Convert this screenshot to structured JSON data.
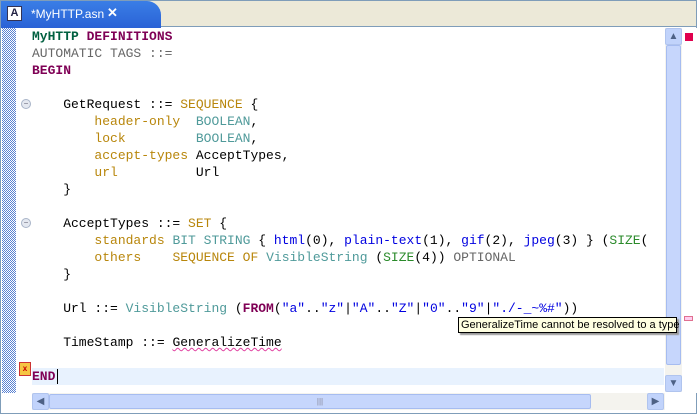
{
  "tab": {
    "title": "*MyHTTP.asn",
    "icon": "asn-file-icon",
    "close": "✕",
    "icon_letter": "A"
  },
  "colors": {
    "keyword": "#7f0055",
    "module": "#006040",
    "type": "#4f9a9a",
    "field": "#b8860b",
    "value": "#0000e0",
    "size": "#2a8a2a",
    "error": "#e0004e"
  },
  "code": [
    [
      [
        "MyHTTP",
        "mod"
      ],
      [
        " ",
        "pl"
      ],
      [
        "DEFINITIONS",
        "kw"
      ]
    ],
    [
      [
        "AUTOMATIC TAGS ::=",
        "gr"
      ]
    ],
    [
      [
        "BEGIN",
        "kw"
      ]
    ],
    [],
    [
      [
        "    GetRequest ::= ",
        "pl"
      ],
      [
        "SEQUENCE",
        "or"
      ],
      [
        " {",
        "pl"
      ]
    ],
    [
      [
        "        ",
        "pl"
      ],
      [
        "header-only",
        "or"
      ],
      [
        "  ",
        "pl"
      ],
      [
        "BOOLEAN",
        "te"
      ],
      [
        ",",
        "pl"
      ]
    ],
    [
      [
        "        ",
        "pl"
      ],
      [
        "lock",
        "or"
      ],
      [
        "         ",
        "pl"
      ],
      [
        "BOOLEAN",
        "te"
      ],
      [
        ",",
        "pl"
      ]
    ],
    [
      [
        "        ",
        "pl"
      ],
      [
        "accept-types",
        "or"
      ],
      [
        " AcceptTypes,",
        "pl"
      ]
    ],
    [
      [
        "        ",
        "pl"
      ],
      [
        "url",
        "or"
      ],
      [
        "          Url",
        "pl"
      ]
    ],
    [
      [
        "    }",
        "pl"
      ]
    ],
    [],
    [
      [
        "    AcceptTypes ::= ",
        "pl"
      ],
      [
        "SET",
        "or"
      ],
      [
        " {",
        "pl"
      ]
    ],
    [
      [
        "        ",
        "pl"
      ],
      [
        "standards",
        "or"
      ],
      [
        " ",
        "pl"
      ],
      [
        "BIT STRING",
        "te"
      ],
      [
        " { ",
        "pl"
      ],
      [
        "html",
        "bl"
      ],
      [
        "(0), ",
        "pl"
      ],
      [
        "plain-text",
        "bl"
      ],
      [
        "(1), ",
        "pl"
      ],
      [
        "gif",
        "bl"
      ],
      [
        "(2), ",
        "pl"
      ],
      [
        "jpeg",
        "bl"
      ],
      [
        "(3) } (",
        "pl"
      ],
      [
        "SIZE",
        "gn"
      ],
      [
        "(",
        "pl"
      ]
    ],
    [
      [
        "        ",
        "pl"
      ],
      [
        "others",
        "or"
      ],
      [
        "    ",
        "pl"
      ],
      [
        "SEQUENCE OF",
        "or"
      ],
      [
        " ",
        "pl"
      ],
      [
        "VisibleString",
        "te"
      ],
      [
        " (",
        "pl"
      ],
      [
        "SIZE",
        "gn"
      ],
      [
        "(4)) ",
        "pl"
      ],
      [
        "OPTIONAL",
        "gr"
      ]
    ],
    [
      [
        "    }",
        "pl"
      ]
    ],
    [],
    [
      [
        "    Url ::= ",
        "pl"
      ],
      [
        "VisibleString",
        "te"
      ],
      [
        " (",
        "pl"
      ],
      [
        "FROM",
        "kw"
      ],
      [
        "(",
        "pl"
      ],
      [
        "\"a\"",
        "bl"
      ],
      [
        "..",
        "pl"
      ],
      [
        "\"z\"",
        "bl"
      ],
      [
        "|",
        "pl"
      ],
      [
        "\"A\"",
        "bl"
      ],
      [
        "..",
        "pl"
      ],
      [
        "\"Z\"",
        "bl"
      ],
      [
        "|",
        "pl"
      ],
      [
        "\"0\"",
        "bl"
      ],
      [
        "..",
        "pl"
      ],
      [
        "\"9\"",
        "bl"
      ],
      [
        "|",
        "pl"
      ],
      [
        "\"./-_~%#\"",
        "bl"
      ],
      [
        "))",
        "pl"
      ]
    ],
    [],
    [
      [
        "    TimeStamp ::= ",
        "pl"
      ],
      [
        "GeneralizeTime",
        "pl err"
      ]
    ],
    [],
    [
      [
        "END",
        "kw"
      ]
    ]
  ],
  "tooltip": "GeneralizeTime cannot be resolved to a type",
  "scroll": {
    "up": "▲",
    "down": "▼",
    "left": "◀",
    "right": "▶",
    "grip": "|||"
  }
}
